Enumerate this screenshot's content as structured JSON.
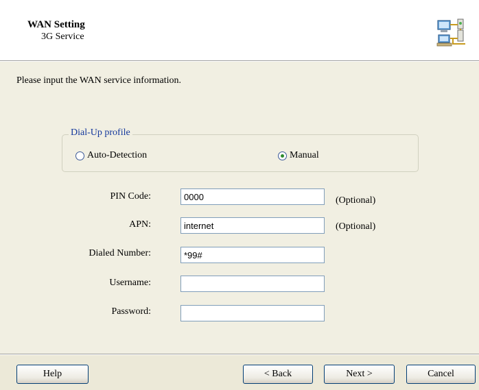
{
  "header": {
    "title": "WAN Setting",
    "subtitle": "3G Service",
    "icon": "network-computers-icon"
  },
  "intro_text": "Please input the WAN service information.",
  "dialup": {
    "legend": "Dial-Up profile",
    "options": [
      {
        "label": "Auto-Detection",
        "selected": false
      },
      {
        "label": "Manual",
        "selected": true
      }
    ]
  },
  "fields": {
    "pin": {
      "label": "PIN Code:",
      "value": "0000",
      "note": "(Optional)"
    },
    "apn": {
      "label": "APN:",
      "value": "internet",
      "note": "(Optional)"
    },
    "dialed": {
      "label": "Dialed Number:",
      "value": "*99#"
    },
    "username": {
      "label": "Username:",
      "value": ""
    },
    "password": {
      "label": "Password:",
      "value": ""
    }
  },
  "buttons": {
    "help": "Help",
    "back": "< Back",
    "next": "Next >",
    "cancel": "Cancel"
  },
  "colors": {
    "legend": "#14389C",
    "dialog_bg": "#F1EFE2",
    "button_border": "#003C74"
  }
}
